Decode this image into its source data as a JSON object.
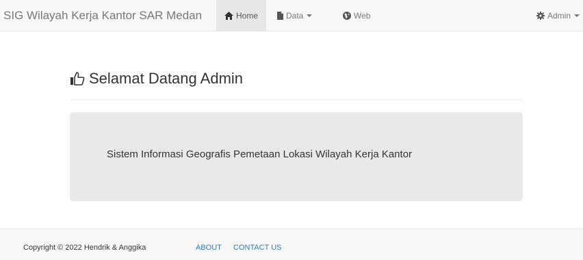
{
  "navbar": {
    "brand": "SIG Wilayah Kerja Kantor SAR Medan",
    "items": [
      {
        "label": "Home",
        "icon": "home-icon",
        "active": true
      },
      {
        "label": "Data",
        "icon": "file-icon",
        "dropdown": true
      },
      {
        "label": "Web",
        "icon": "globe-icon"
      }
    ],
    "user": {
      "label": "Admin",
      "icon": "gear-icon",
      "dropdown": true
    }
  },
  "main": {
    "title": "Selamat Datang Admin",
    "title_icon": "thumbs-up-icon",
    "jumbotron_text": "Sistem Informasi Geografis Pemetaan Lokasi Wilayah Kerja Kantor"
  },
  "footer": {
    "copyright": "Copyright © 2022 Hendrik & Anggika",
    "links": [
      "ABOUT",
      "CONTACT US"
    ]
  },
  "colors": {
    "navbar_bg": "#f8f8f8",
    "active_bg": "#e7e7e7",
    "jumbotron_bg": "#e9e9e9",
    "link": "#337ab7"
  }
}
